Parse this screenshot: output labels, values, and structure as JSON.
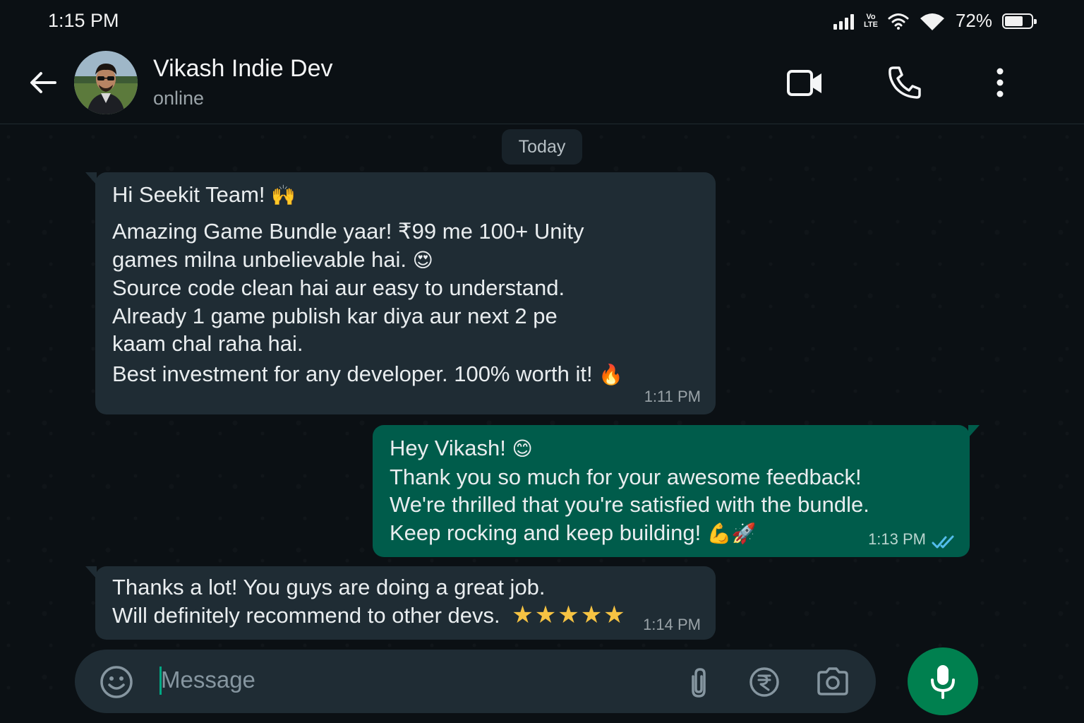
{
  "status_bar": {
    "time": "1:15 PM",
    "volte_top": "Vo",
    "volte_bottom": "LTE",
    "battery_percent": "72%",
    "battery_level": 0.72
  },
  "header": {
    "contact_name": "Vikash Indie Dev",
    "contact_status": "online",
    "icons": [
      "back-arrow-icon",
      "video-call-icon",
      "voice-call-icon",
      "more-options-icon"
    ]
  },
  "chat": {
    "date_label": "Today",
    "messages": [
      {
        "direction": "incoming",
        "greeting": "Hi Seekit Team!",
        "greeting_emoji": "🙌",
        "lines": [
          "Amazing Game Bundle yaar! ₹99 me 100+ Unity",
          "games milna unbelievable hai.",
          "Source code clean hai aur easy to understand.",
          "Already 1 game publish kar diya aur next 2 pe",
          "kaam chal raha hai."
        ],
        "line2_emoji": "😍",
        "closing": "Best investment for any developer. 100% worth it!",
        "closing_emoji": "🔥",
        "time": "1:11 PM"
      },
      {
        "direction": "outgoing",
        "lines": [
          "Hey Vikash!",
          "Thank you so much for your awesome feedback!",
          "We're thrilled that you're satisfied with the bundle.",
          "Keep rocking and keep building!"
        ],
        "line1_emoji": "😊",
        "line4_emoji": "💪🚀",
        "time": "1:13 PM",
        "read_status": "read"
      },
      {
        "direction": "incoming",
        "lines": [
          "Thanks a lot! You guys are doing a great job.",
          "Will definitely recommend to other devs."
        ],
        "stars": "★★★★★",
        "time": "1:14 PM"
      }
    ]
  },
  "composer": {
    "placeholder": "Message",
    "icons": [
      "emoji-icon",
      "attach-icon",
      "rupee-payment-icon",
      "camera-icon",
      "microphone-icon"
    ]
  },
  "colors": {
    "background": "#0b1014",
    "incoming_bubble": "#1f2c34",
    "outgoing_bubble": "#005c4b",
    "accent": "#00a884",
    "read_tick": "#53bdeb",
    "mic_button": "#00804f"
  }
}
